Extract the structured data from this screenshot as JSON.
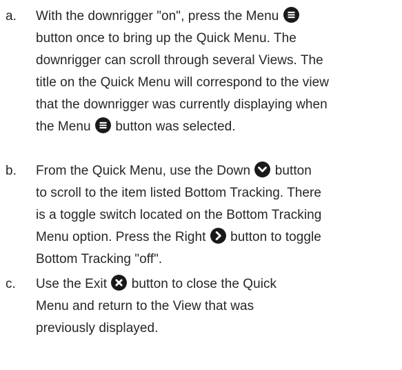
{
  "steps": [
    {
      "marker": "a.",
      "lines": [
        {
          "before": "With the downrigger \"on\", press the Menu",
          "icon": "menu-icon",
          "after": ""
        },
        {
          "before": "button once to bring up the Quick Menu. The",
          "icon": null,
          "after": ""
        },
        {
          "before": "downrigger can scroll through several Views. The",
          "icon": null,
          "after": ""
        },
        {
          "before": "title on the Quick Menu will correspond to the view",
          "icon": null,
          "after": ""
        },
        {
          "before": "that the downrigger was currently displaying when",
          "icon": null,
          "after": ""
        },
        {
          "before": "the Menu",
          "icon": "menu-icon",
          "after": "button was selected."
        }
      ]
    },
    {
      "marker": "b.",
      "lines": [
        {
          "before": "From the Quick Menu, use the Down",
          "icon": "chevron-down-icon",
          "after": "button"
        },
        {
          "before": "to scroll to the item listed Bottom Tracking. There",
          "icon": null,
          "after": ""
        },
        {
          "before": "is a toggle switch located on the Bottom Tracking",
          "icon": null,
          "after": ""
        },
        {
          "before": "Menu option. Press the Right",
          "icon": "chevron-right-icon",
          "after": "button to toggle"
        },
        {
          "before": "Bottom Tracking \"off\".",
          "icon": null,
          "after": ""
        }
      ]
    },
    {
      "marker": "c.",
      "lines": [
        {
          "before": "Use the Exit",
          "icon": "close-icon",
          "after": "button to close the Quick"
        },
        {
          "before": "Menu and return to the View that was",
          "icon": null,
          "after": ""
        },
        {
          "before": "previously displayed.",
          "icon": null,
          "after": ""
        }
      ]
    }
  ]
}
